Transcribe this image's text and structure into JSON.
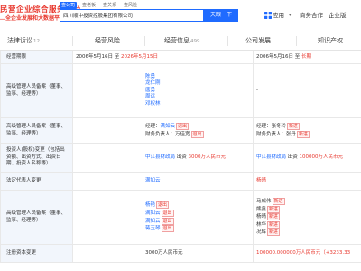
{
  "logo": {
    "line1": "民营企业综合服务平台",
    "line2": "…全企业发展和大数据平台"
  },
  "search": {
    "tabs": [
      "查公司",
      "查老板",
      "查关系",
      "查风险"
    ],
    "value": "四川顺中投资控股集团有限公司",
    "button": "天眼一下"
  },
  "nav": {
    "app": "应用",
    "business": "商务合作",
    "enterprise": "企业版"
  },
  "tabs": [
    {
      "label": "法律诉讼",
      "count": "12"
    },
    {
      "label": "经营风险",
      "count": ""
    },
    {
      "label": "经营信息",
      "count": "499"
    },
    {
      "label": "公司发展",
      "count": ""
    },
    {
      "label": "知识产权",
      "count": ""
    }
  ],
  "rows": {
    "r0": {
      "label": "经营期限",
      "left_start": "2006年5月16日",
      "left_sep": "至",
      "left_end": "2026年5月15日",
      "right_start": "2006年5月16日",
      "right_sep": "至",
      "right_end": "长期"
    },
    "r1": {
      "label": "高级管理人员备案（董事、监事、经理等）",
      "names": [
        "陈勇",
        "龙仁刚",
        "唐勇",
        "周远",
        "邓权林"
      ],
      "right": "-"
    },
    "r2": {
      "label": "高级管理人员备案（董事、监事、经理等）",
      "left_line1_prefix": "经理：",
      "left_line1_name": "满如云",
      "left_line1_tag": "退出",
      "left_line2_prefix": "财务负责人：",
      "left_line2_name": "万佳宽",
      "left_line2_tag": "退出",
      "right_line1_prefix": "经理：",
      "right_line1_name": "张冬玲",
      "right_line1_tag": "新进",
      "right_line2_prefix": "财务负责人：",
      "right_line2_name": "张丹",
      "right_line2_tag": "新进"
    },
    "r3": {
      "label": "投资人(股权)变更（包括出资额、出资方式、出资日期、投资人名称等）",
      "left_name": "中江县财政局",
      "left_text": "出资",
      "left_amount": "3000万人民币元",
      "right_name": "中江县财政局",
      "right_text": "出资",
      "right_amount": "100000万人民币元"
    },
    "r4": {
      "label": "法定代表人变更",
      "left": "满如云",
      "right": "杨晴"
    },
    "r5": {
      "label": "高级管理人员备案（董事、监事、经理等）",
      "left": [
        {
          "name": "杨艳",
          "tag": "退出"
        },
        {
          "name": "满如云",
          "tag": "退出"
        },
        {
          "name": "满如云",
          "tag": "退出"
        },
        {
          "name": "蒋玉琴",
          "tag": "退出"
        }
      ],
      "right": [
        {
          "name": "马成伟",
          "tag": "新进"
        },
        {
          "name": "熊鑫",
          "tag": "新进"
        },
        {
          "name": "杨晴",
          "tag": "新进"
        },
        {
          "name": "林华",
          "tag": "新进"
        },
        {
          "name": "况辉",
          "tag": "新进"
        }
      ]
    },
    "r6": {
      "label": "注册资本变更",
      "left": "3000万人民币元",
      "right": "100000.000000万人民币元（+3233.33"
    }
  },
  "colors": {
    "brand": "#1f6bff",
    "red": "#e8382e",
    "label_bg": "#f2f6fc"
  }
}
